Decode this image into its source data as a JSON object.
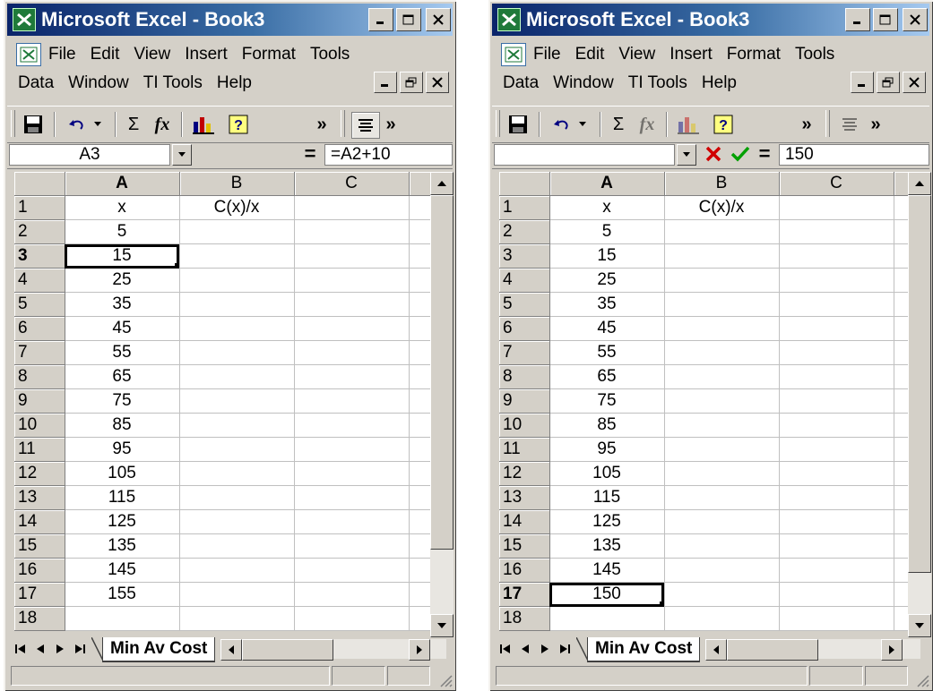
{
  "windows": [
    {
      "id": "left",
      "title": "Microsoft Excel - Book3",
      "menu": {
        "row1": [
          "File",
          "Edit",
          "View",
          "Insert",
          "Format",
          "Tools"
        ],
        "row2": [
          "Data",
          "Window",
          "TI Tools",
          "Help"
        ]
      },
      "toolbar": {
        "sigma": "Σ",
        "fx": "fx",
        "more": "»"
      },
      "formula_bar": {
        "name_box": "A3",
        "equals": "=",
        "content": "=A2+10"
      },
      "columns": [
        "A",
        "B",
        "C"
      ],
      "active_column": "A",
      "rows": [
        {
          "num": "1",
          "a": "x",
          "b": "C(x)/x"
        },
        {
          "num": "2",
          "a": "5",
          "b": ""
        },
        {
          "num": "3",
          "a": "15",
          "b": ""
        },
        {
          "num": "4",
          "a": "25",
          "b": ""
        },
        {
          "num": "5",
          "a": "35",
          "b": ""
        },
        {
          "num": "6",
          "a": "45",
          "b": ""
        },
        {
          "num": "7",
          "a": "55",
          "b": ""
        },
        {
          "num": "8",
          "a": "65",
          "b": ""
        },
        {
          "num": "9",
          "a": "75",
          "b": ""
        },
        {
          "num": "10",
          "a": "85",
          "b": ""
        },
        {
          "num": "11",
          "a": "95",
          "b": ""
        },
        {
          "num": "12",
          "a": "105",
          "b": ""
        },
        {
          "num": "13",
          "a": "115",
          "b": ""
        },
        {
          "num": "14",
          "a": "125",
          "b": ""
        },
        {
          "num": "15",
          "a": "135",
          "b": ""
        },
        {
          "num": "16",
          "a": "145",
          "b": ""
        },
        {
          "num": "17",
          "a": "155",
          "b": ""
        },
        {
          "num": "18",
          "a": "",
          "b": ""
        }
      ],
      "selected_row": "3",
      "sheet_tab": "Min Av Cost"
    },
    {
      "id": "right",
      "title": "Microsoft Excel - Book3",
      "menu": {
        "row1": [
          "File",
          "Edit",
          "View",
          "Insert",
          "Format",
          "Tools"
        ],
        "row2": [
          "Data",
          "Window",
          "TI Tools",
          "Help"
        ]
      },
      "toolbar": {
        "sigma": "Σ",
        "fx": "fx",
        "more": "»"
      },
      "formula_bar": {
        "name_box": "",
        "equals": "=",
        "content": "150"
      },
      "columns": [
        "A",
        "B",
        "C"
      ],
      "active_column": "A",
      "rows": [
        {
          "num": "1",
          "a": "x",
          "b": "C(x)/x"
        },
        {
          "num": "2",
          "a": "5",
          "b": ""
        },
        {
          "num": "3",
          "a": "15",
          "b": ""
        },
        {
          "num": "4",
          "a": "25",
          "b": ""
        },
        {
          "num": "5",
          "a": "35",
          "b": ""
        },
        {
          "num": "6",
          "a": "45",
          "b": ""
        },
        {
          "num": "7",
          "a": "55",
          "b": ""
        },
        {
          "num": "8",
          "a": "65",
          "b": ""
        },
        {
          "num": "9",
          "a": "75",
          "b": ""
        },
        {
          "num": "10",
          "a": "85",
          "b": ""
        },
        {
          "num": "11",
          "a": "95",
          "b": ""
        },
        {
          "num": "12",
          "a": "105",
          "b": ""
        },
        {
          "num": "13",
          "a": "115",
          "b": ""
        },
        {
          "num": "14",
          "a": "125",
          "b": ""
        },
        {
          "num": "15",
          "a": "135",
          "b": ""
        },
        {
          "num": "16",
          "a": "145",
          "b": ""
        },
        {
          "num": "17",
          "a": "150",
          "b": ""
        },
        {
          "num": "18",
          "a": "",
          "b": ""
        }
      ],
      "selected_row": "17",
      "sheet_tab": "Min Av Cost"
    }
  ],
  "colors": {
    "title_gradient_start": "#0a246a",
    "title_gradient_end": "#a6caf0",
    "chrome": "#d4d0c8",
    "cancel_red": "#d00000",
    "enter_green": "#00a000",
    "excel_green": "#1f7a3a"
  }
}
